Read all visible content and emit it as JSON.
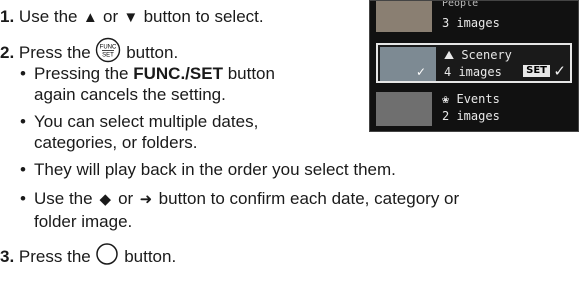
{
  "steps": {
    "s1": {
      "num": "1.",
      "pre": "Use the",
      "or": "or",
      "post": "button to select.",
      "up": "▲",
      "down": "▼"
    },
    "s2": {
      "num": "2.",
      "pre": "Press the",
      "post": "button.",
      "icon_text_top": "FUNC",
      "icon_text_bottom": "SET"
    },
    "b1a": {
      "pre": "Pressing the",
      "bold": "FUNC./SET",
      "post": "button"
    },
    "b1b": "again cancels the setting.",
    "b2a": "You can select multiple dates,",
    "b2b": "categories, or folders.",
    "b3": "They will play back in the order you select them.",
    "b4a": {
      "pre": "Use the",
      "or": "or",
      "post": "button to confirm each date, category or",
      "left": "◆",
      "right": "➜"
    },
    "b4b": "folder image.",
    "s3": {
      "num": "3.",
      "pre": "Press the",
      "post": "button."
    },
    "bullet": "•"
  },
  "lcd": {
    "row1": {
      "count": "3 images",
      "name": "People"
    },
    "row2": {
      "name": "Scenery",
      "count": "4 images",
      "badge": "SET",
      "check": "✓",
      "thumb_check": "✓"
    },
    "row3": {
      "name": "Events",
      "count": "2 images"
    }
  }
}
